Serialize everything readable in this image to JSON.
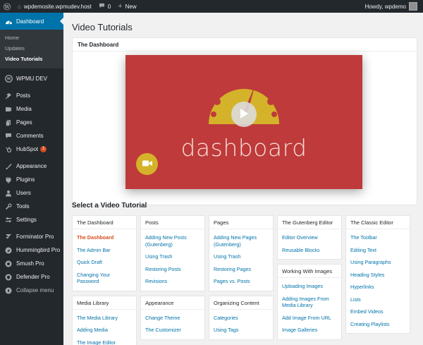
{
  "adminbar": {
    "site": "wpdemosite.wpmudev.host",
    "comments_count": "0",
    "new_label": "New",
    "howdy": "Howdy, wpdemo"
  },
  "sidebar": {
    "dashboard": "Dashboard",
    "submenu": [
      "Home",
      "Updates",
      "Video Tutorials"
    ],
    "wpmudev": "WPMU DEV",
    "items": [
      {
        "label": "Posts",
        "icon": "pin-icon"
      },
      {
        "label": "Media",
        "icon": "media-icon"
      },
      {
        "label": "Pages",
        "icon": "pages-icon"
      },
      {
        "label": "Comments",
        "icon": "comments-icon"
      },
      {
        "label": "HubSpot",
        "icon": "hubspot-icon",
        "badge": "1"
      }
    ],
    "items2": [
      {
        "label": "Appearance",
        "icon": "brush-icon"
      },
      {
        "label": "Plugins",
        "icon": "plugin-icon"
      },
      {
        "label": "Users",
        "icon": "user-icon"
      },
      {
        "label": "Tools",
        "icon": "wrench-icon"
      },
      {
        "label": "Settings",
        "icon": "settings-icon"
      }
    ],
    "items3": [
      {
        "label": "Forminator Pro",
        "icon": "forminator-icon"
      },
      {
        "label": "Hummingbird Pro",
        "icon": "hummingbird-icon"
      },
      {
        "label": "Smush Pro",
        "icon": "smush-icon"
      },
      {
        "label": "Defender Pro",
        "icon": "defender-icon"
      }
    ],
    "collapse": "Collapse menu"
  },
  "main": {
    "title": "Video Tutorials",
    "video_box_title": "The Dashboard",
    "video_word": "dashboard",
    "section_title": "Select a Video Tutorial"
  },
  "columns": [
    [
      {
        "title": "The Dashboard",
        "links": [
          "The Dashboard",
          "The Admin Bar",
          "Quick Draft",
          "Changing Your Password"
        ],
        "active": 0
      },
      {
        "title": "Media Library",
        "links": [
          "The Media Library",
          "Adding Media",
          "The Image Editor"
        ]
      }
    ],
    [
      {
        "title": "Posts",
        "links": [
          "Adding New Posts (Gutenberg)",
          "Using Trash",
          "Restoring Posts",
          "Revisions"
        ]
      },
      {
        "title": "Appearance",
        "links": [
          "Change Theme",
          "The Customizer"
        ]
      }
    ],
    [
      {
        "title": "Pages",
        "links": [
          "Adding New Pages (Gutenberg)",
          "Using Trash",
          "Restoring Pages",
          "Pages vs. Posts"
        ]
      },
      {
        "title": "Organizing Content",
        "links": [
          "Categories",
          "Using Tags"
        ]
      }
    ],
    [
      {
        "title": "The Gutenberg Editor",
        "links": [
          "Editor Overview",
          "Reusable Blocks"
        ]
      },
      {
        "title": "Working With Images",
        "links": [
          "Uploading Images",
          "Adding Images From Media Library",
          "Add Image From URL",
          "Image Galleries"
        ]
      }
    ],
    [
      {
        "title": "The Classic Editor",
        "links": [
          "The Toolbar",
          "Editing Text",
          "Using Paragraphs",
          "Heading Styles",
          "Hyperlinks",
          "Lists",
          "Embed Videos",
          "Creating Playlists"
        ]
      }
    ]
  ],
  "colors": {
    "accent": "#0073aa",
    "adminbar": "#23282d",
    "video_bg": "#bf3a3a",
    "gauge": "#d4b32a",
    "active_link": "#d54e21"
  }
}
